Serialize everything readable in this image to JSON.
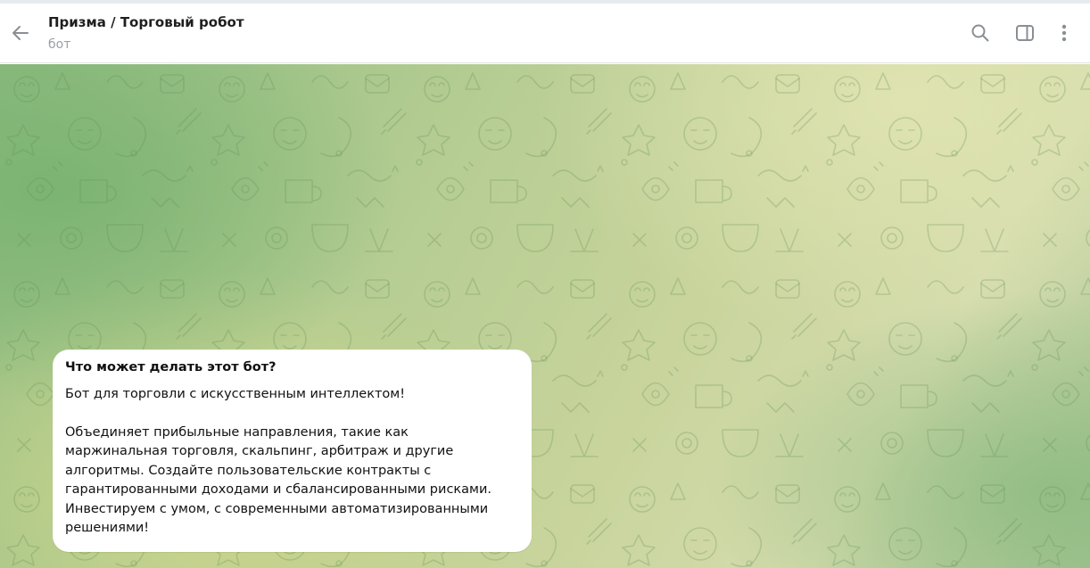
{
  "header": {
    "title": "Призма / Торговый робот",
    "subtitle": "бот",
    "icons": [
      "back-arrow-icon",
      "search-icon",
      "sidebar-toggle-icon",
      "more-vertical-icon"
    ]
  },
  "bot_info": {
    "heading": "Что может делать этот бот?",
    "paragraph1": "Бот для торговли с искусственным интеллектом!",
    "paragraph2": "Объединяет прибыльные направления, такие как\nмаржинальная торговля, скальпинг, арбитраж и другие\nалгоритмы. Создайте пользовательские контракты с\nгарантированными доходами и сбалансированными рисками.\nИнвестируем с умом, с современными автоматизированными\nрешениями!"
  },
  "colors": {
    "header_bg": "#ffffff",
    "icon": "#8a8f94",
    "bubble_bg": "#ffffff",
    "wallpaper_green": "#8dbb80",
    "wallpaper_yellow": "#d5dcad"
  }
}
